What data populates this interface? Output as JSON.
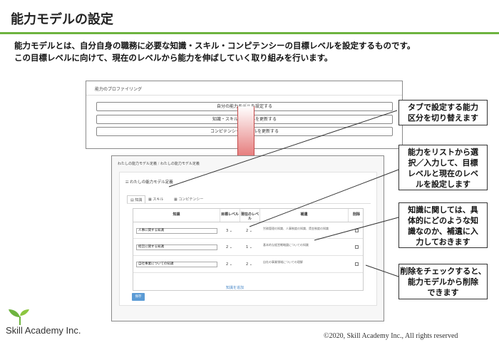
{
  "slide": {
    "title": "能力モデルの設定",
    "intro_line1": "能力モデルとは、自分自身の職務に必要な知識・スキル・コンピテンシーの目標レベルを設定するものです。",
    "intro_line2": "この目標レベルに向けて、現在のレベルから能力を伸ばしていく取り組みを行います。"
  },
  "profiling": {
    "header": "能力のプロファイリング",
    "buttons": [
      "自分の能力モデルを設定する",
      "知識・スキルのレベルを更新する",
      "コンピテンシーのレベルを更新する"
    ]
  },
  "editor": {
    "breadcrumb_parent": "わたしの能力モデル定義",
    "breadcrumb_sep": "/",
    "breadcrumb_current": "わたしの能力モデル定義",
    "panel_title": "わたしの能力モデル定義",
    "tabs": [
      "知識",
      "スキル",
      "コンピテンシー"
    ],
    "columns": [
      "知識",
      "目標レベル",
      "現在のレベル",
      "補遺",
      "削除"
    ],
    "rows": [
      {
        "name": "人事に関する知識",
        "target": "3",
        "current": "2",
        "note": "労務管理の知識、人事制度の知識、賃金制度の知識"
      },
      {
        "name": "経営に関する知識",
        "target": "2",
        "current": "1",
        "note": "基本的な経営戦略論についての知識"
      },
      {
        "name": "自社事業についての知識",
        "target": "2",
        "current": "2",
        "note": "自社の事業領域についての理解"
      }
    ],
    "add_link": "知識を追加",
    "save_label": "保存"
  },
  "callouts": {
    "c1": [
      "タブで設定する能力",
      "区分を切り替えます"
    ],
    "c2": [
      "能力をリストから選",
      "択／入力して、目標",
      "レベルと現在のレベ",
      "ルを設定します"
    ],
    "c3": [
      "知識に関しては、具",
      "体的にどのような知",
      "識なのか、補遺に入",
      "力しておきます"
    ],
    "c4": [
      "削除をチェックすると、",
      "能力モデルから削除",
      "できます"
    ]
  },
  "footer": {
    "logo_text": "Skill Academy Inc.",
    "copyright": "©2020, Skill Academy Inc.,  All rights reserved"
  },
  "colors": {
    "accent_green": "#6db33f",
    "arrow_red": "#d94848",
    "save_blue": "#5b9bd5",
    "link_blue": "#4a89c8"
  }
}
